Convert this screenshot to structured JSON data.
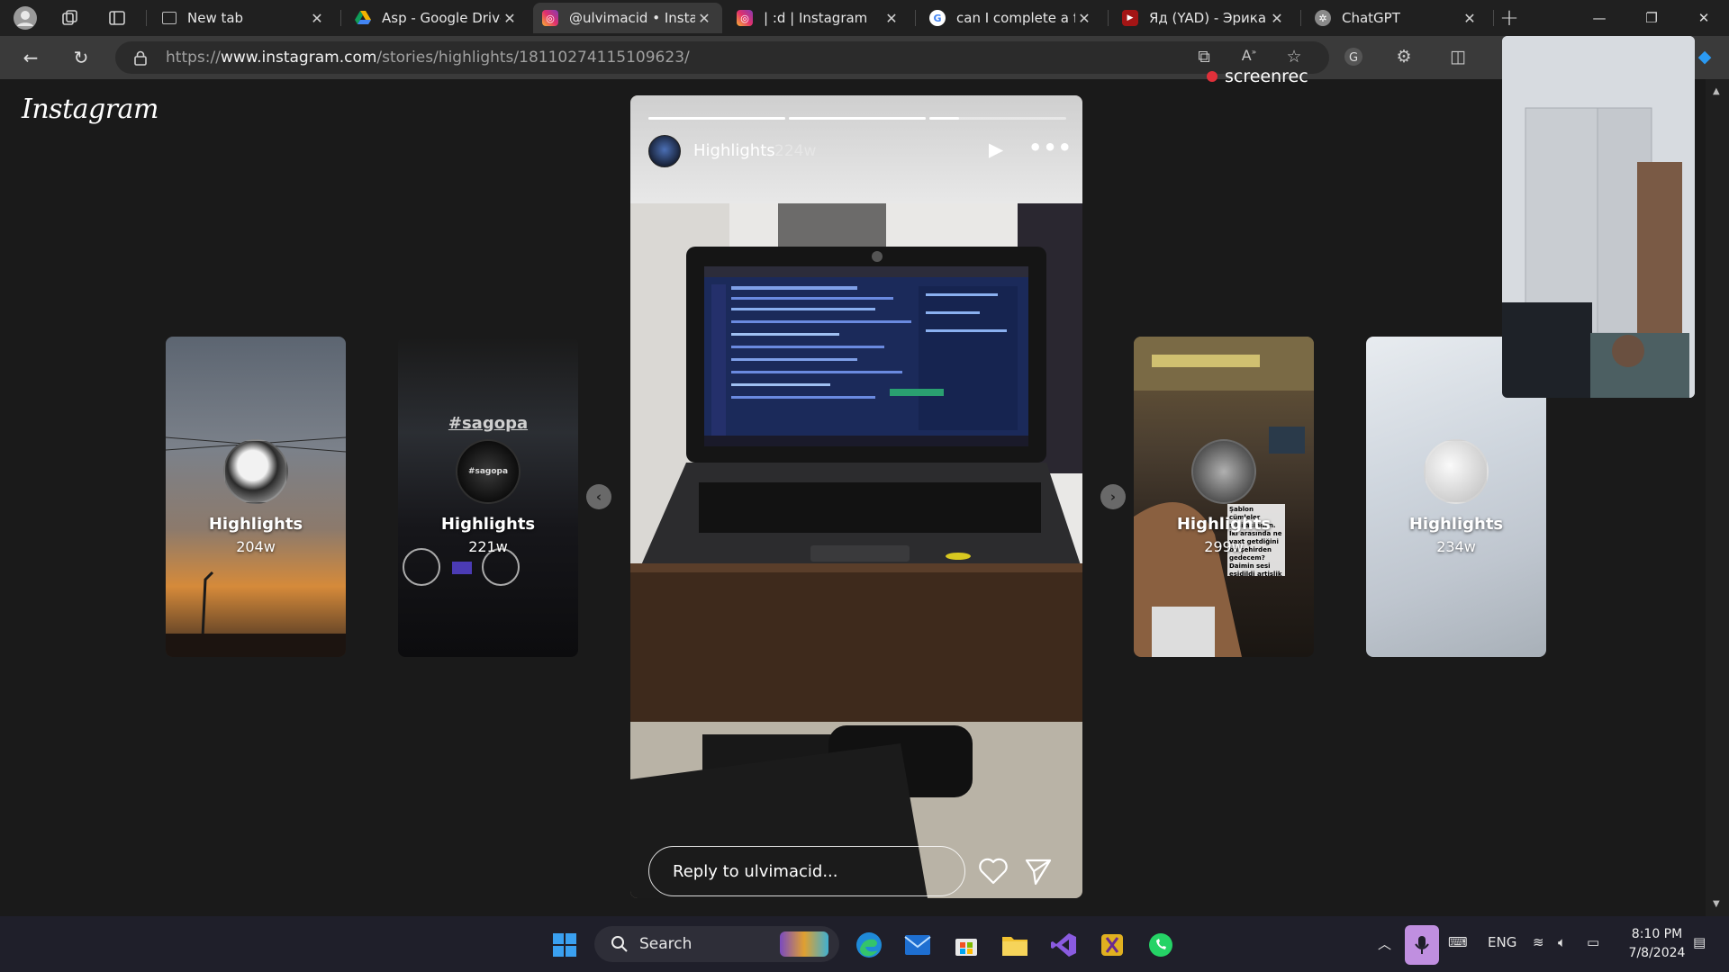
{
  "browser": {
    "tabs": [
      {
        "title": "New tab",
        "icon": "new-tab-icon",
        "active": false
      },
      {
        "title": "Asp - Google Drive",
        "icon": "google-drive-icon",
        "active": false
      },
      {
        "title": "@ulvimacid • Instag",
        "icon": "instagram-icon",
        "active": true
      },
      {
        "title": "| :d | Instagram",
        "icon": "instagram-icon",
        "active": false
      },
      {
        "title": "can I complete a ful",
        "icon": "google-icon",
        "active": false
      },
      {
        "title": "Яд (YAD) - Эрика Л",
        "icon": "youtube-icon",
        "active": false
      },
      {
        "title": "ChatGPT",
        "icon": "chatgpt-icon",
        "active": false
      }
    ],
    "url_prefix": "https://",
    "url_host": "www.instagram.com",
    "url_path": "/stories/highlights/18110274115109623/",
    "screenrec_label": "screenrec"
  },
  "instagram": {
    "logo_text": "Instagram",
    "side_cards": [
      {
        "label": "Highlights",
        "age": "204w"
      },
      {
        "label": "Highlights",
        "age": "221w",
        "overlay_text": "#sagopa",
        "avatar_text": "#sagopa"
      },
      {
        "label": "Highlights",
        "age": "299w",
        "overlay_caption": "Şablon cümleler silsilasindan. İki arasında ne vaxt getdiğini bu şehirden gedecem? Daimin sesi eşidildi artislik yampa lan"
      },
      {
        "label": "Highlights",
        "age": "234w"
      }
    ],
    "story": {
      "username": "Highlights",
      "age": "224w",
      "progress": [
        1.0,
        1.0,
        0.22
      ],
      "reply_placeholder": "Reply to ulvimacid..."
    }
  },
  "taskbar": {
    "search_label": "Search",
    "language": "ENG",
    "time": "8:10 PM",
    "date": "7/8/2024",
    "colors": {
      "accent": "#0078d4",
      "mic": "#c08fe0"
    }
  }
}
